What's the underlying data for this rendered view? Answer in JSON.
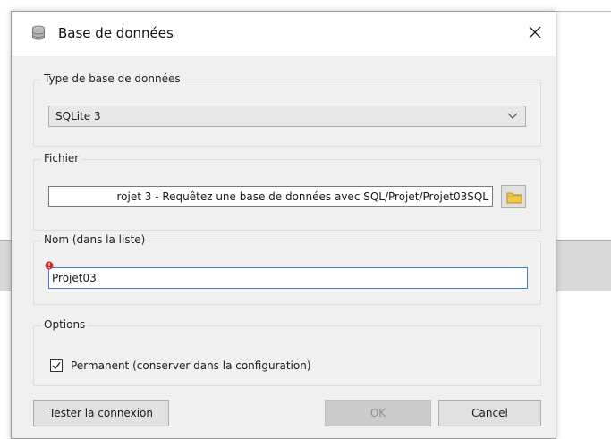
{
  "dialog": {
    "title": "Base de données",
    "icon": "database-icon"
  },
  "database_type": {
    "legend": "Type de base de données",
    "selected": "SQLite 3"
  },
  "file": {
    "legend": "Fichier",
    "value": "rojet 3 - Requêtez une base de données avec SQL/Projet/Projet03SQL",
    "browse_icon": "folder-icon"
  },
  "name": {
    "legend": "Nom (dans la liste)",
    "value": "Projet03"
  },
  "options": {
    "legend": "Options",
    "permanent_label": "Permanent (conserver dans la configuration)",
    "permanent_checked": true
  },
  "buttons": {
    "test": "Tester la connexion",
    "ok": "OK",
    "cancel": "Cancel"
  }
}
